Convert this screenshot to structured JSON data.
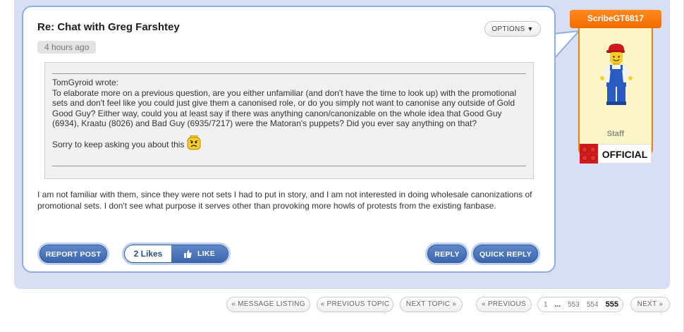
{
  "post": {
    "title": "Re: Chat with Greg Farshtey",
    "time": "4 hours ago",
    "options_label": "OPTIONS",
    "quote": {
      "author_line": "TomGyroid wrote:",
      "body": "To elaborate more on a previous question, are you either unfamiliar (and don't have the time to look up) with the promotional sets and don't feel like you could just give them a canonised role, or do you simply not want to canonise any outside of Gold Good Guy? Either way, could you at least say if there was anything canon/canonizable on the whole idea that Good Guy (6934), Kraatu (8026) and Bad Guy (6935/7217) were the Matoran's puppets? Did you ever say anything on that?",
      "closing": "Sorry to keep asking you about this",
      "emoji_icon": "sad-face-icon"
    },
    "reply": "I am not familiar with them, since they were not sets I had to put in story, and I am not interested in doing wholesale canonizations of promotional sets. I don't see what purpose it serves other than provoking more howls of protests from the existing fanbase.",
    "actions": {
      "report_label": "REPORT POST",
      "likes_count": "2 Likes",
      "like_label": "LIKE",
      "like_icon": "thumbs-up-icon",
      "reply_label": "REPLY",
      "quick_reply_label": "QUICK REPLY"
    }
  },
  "author": {
    "username": "ScribeGT6817",
    "role": "Staff",
    "badge": "OFFICIAL",
    "avatar_icon": "minifigure-avatar-icon"
  },
  "navigation": {
    "message_listing": "« MESSAGE LISTING",
    "previous_topic": "« PREVIOUS TOPIC",
    "next_topic": "NEXT TOPIC »",
    "previous": "« PREVIOUS",
    "next": "NEXT »",
    "pages": {
      "first": "1",
      "ellipsis": "...",
      "p553": "553",
      "p554": "554",
      "current": "555"
    }
  },
  "colors": {
    "panel_bg": "#d8dff2",
    "card_border": "#8eaee0",
    "button_blue": "#3c67ad",
    "username_tab": "#f26b00",
    "badge_red": "#d11c1c"
  }
}
